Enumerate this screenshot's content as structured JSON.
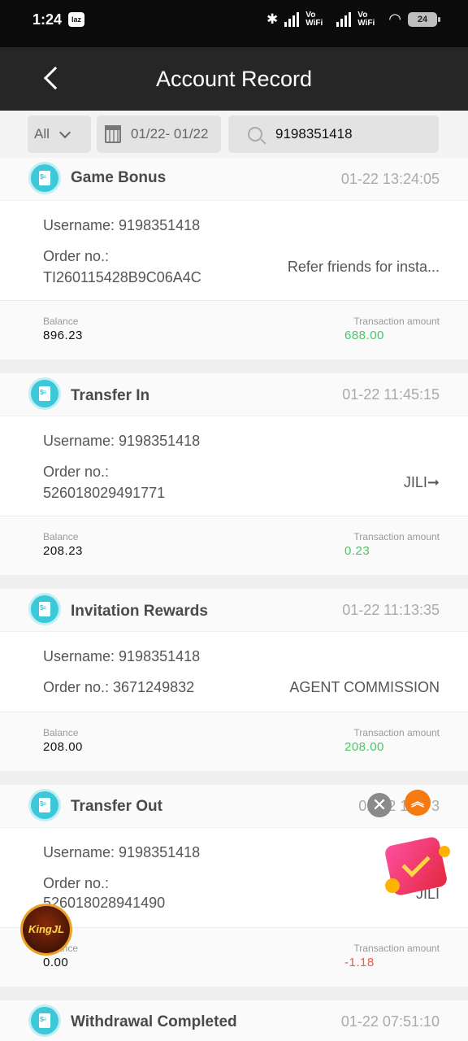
{
  "status_bar": {
    "time": "1:24",
    "app_badge": "laz",
    "vowifi_1": "Vo WiFi",
    "vowifi_2": "Vo WiFi",
    "battery": "24"
  },
  "header": {
    "title": "Account Record"
  },
  "filters": {
    "type_value": "All",
    "date_range": "01/22- 01/22",
    "search_value": "9198351418"
  },
  "labels": {
    "username_prefix": "Username: ",
    "order_prefix": "Order no.:",
    "balance": "Balance",
    "transaction_amount": "Transaction amount"
  },
  "records": [
    {
      "title": "Game Bonus",
      "time": "01-22 13:24:05",
      "username": "Username: 9198351418",
      "order_label": "Order no.:",
      "order_no": "TI260115428B9C06A4C",
      "note": "Refer friends for insta...",
      "balance": "896.23",
      "amount": "688.00"
    },
    {
      "title": "Transfer In",
      "time": "01-22 11:45:15",
      "username": "Username: 9198351418",
      "order_label": "Order no.:",
      "order_no": "526018029491771",
      "note": "JILI➞",
      "balance": "208.23",
      "amount": "0.23"
    },
    {
      "title": "Invitation Rewards",
      "time": "01-22 11:13:35",
      "username": "Username: 9198351418",
      "order_inline": "Order no.: 3671249832",
      "note": "AGENT COMMISSION",
      "balance": "208.00",
      "amount": "208.00"
    },
    {
      "title": "Transfer Out",
      "time": "01-22 11:4 3",
      "username": "Username: 9198351418",
      "order_label": "Order no.:",
      "order_no": "526018028941490",
      "note": "JILI",
      "balance_label": "ance",
      "balance": "0.00",
      "amount": "-1.18"
    },
    {
      "title": "Withdrawal Completed",
      "time": "01-22 07:51:10"
    }
  ],
  "overlays": {
    "close": "✕",
    "scroll_top": "︽",
    "logo": "KingJL"
  },
  "colors": {
    "positive": "#4cc46a",
    "negative": "#ee5a45",
    "icon_teal": "#3cc8d8",
    "header_bg": "#262626"
  }
}
